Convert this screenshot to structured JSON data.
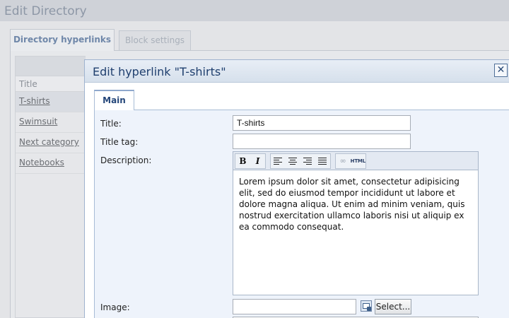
{
  "page": {
    "title": "Edit Directory"
  },
  "tabs": [
    {
      "label": "Directory hyperlinks",
      "active": true
    },
    {
      "label": "Block settings",
      "active": false
    }
  ],
  "grid": {
    "column_header": "Title",
    "rows": [
      "T-shirts",
      "Swimsuit",
      "Next category",
      "Notebooks"
    ]
  },
  "dialog": {
    "title": "Edit hyperlink \"T-shirts\"",
    "close_label": "✕",
    "tab_label": "Main",
    "fields": {
      "title_label": "Title:",
      "title_value": "T-shirts",
      "title_tag_label": "Title tag:",
      "title_tag_value": "",
      "description_label": "Description:",
      "description_value": "Lorem ipsum dolor sit amet, consectetur adipisicing elit, sed do eiusmod tempor incididunt ut labore et dolore magna aliqua. Ut enim ad minim veniam, quis nostrud exercitation ullamco laboris nisi ut aliquip ex ea commodo consequat.",
      "image_label": "Image:",
      "image_value": "",
      "select_button": "Select..."
    },
    "toolbar": {
      "bold": "B",
      "italic": "I",
      "html": "HTML",
      "icons": [
        "bold-icon",
        "italic-icon",
        "align-left-icon",
        "align-center-icon",
        "align-right-icon",
        "align-justify-icon",
        "link-icon",
        "html-icon"
      ]
    }
  },
  "colors": {
    "accent": "#1f3f6e",
    "dialog_border": "#9fb3cf",
    "panel_bg": "#eef3fb"
  }
}
